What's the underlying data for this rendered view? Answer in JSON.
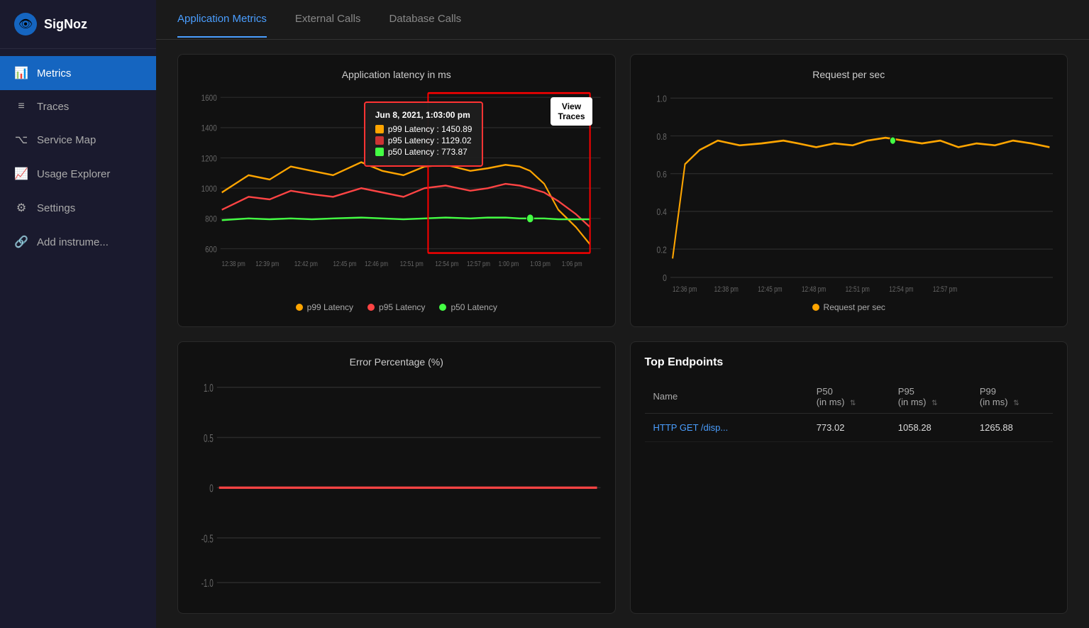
{
  "app": {
    "name": "SigNoz"
  },
  "sidebar": {
    "items": [
      {
        "id": "metrics",
        "label": "Metrics",
        "icon": "📊",
        "active": true
      },
      {
        "id": "traces",
        "label": "Traces",
        "icon": "≡"
      },
      {
        "id": "service-map",
        "label": "Service Map",
        "icon": "⌥"
      },
      {
        "id": "usage-explorer",
        "label": "Usage Explorer",
        "icon": "📈"
      },
      {
        "id": "settings",
        "label": "Settings",
        "icon": "⚙"
      },
      {
        "id": "add-instrument",
        "label": "Add instrume...",
        "icon": "🔗"
      }
    ]
  },
  "tabs": [
    {
      "id": "application-metrics",
      "label": "Application Metrics",
      "active": true
    },
    {
      "id": "external-calls",
      "label": "External Calls",
      "active": false
    },
    {
      "id": "database-calls",
      "label": "Database Calls",
      "active": false
    }
  ],
  "latency_chart": {
    "title": "Application latency in ms",
    "y_axis": [
      "1600",
      "1400",
      "1200",
      "1000",
      "800",
      "600"
    ],
    "x_axis": [
      "12:38 pm",
      "12:39 pm",
      "12:42 pm",
      "12:45 pm",
      "12:46 pm",
      "12:51 pm",
      "12:54 pm",
      "12:57 pm",
      "1:00 pm",
      "1:03 pm",
      "1:06 pm"
    ],
    "tooltip": {
      "date": "Jun 8, 2021, 1:03:00 pm",
      "p99_label": "p99 Latency : 1450.89",
      "p95_label": "p95 Latency : 1129.02",
      "p50_label": "p50 Latency : 773.87"
    },
    "view_traces_btn": "View\nTraces",
    "legend": [
      {
        "label": "p99 Latency",
        "color": "#ffa500"
      },
      {
        "label": "p95 Latency",
        "color": "#ff4444"
      },
      {
        "label": "p50 Latency",
        "color": "#44ff44"
      }
    ]
  },
  "request_chart": {
    "title": "Request per sec",
    "y_axis": [
      "1.0",
      "0.8",
      "0.6",
      "0.4",
      "0.2",
      "0"
    ],
    "legend": [
      {
        "label": "Request per sec",
        "color": "#ffa500"
      }
    ]
  },
  "error_chart": {
    "title": "Error Percentage (%)",
    "y_axis": [
      "1.0",
      "0.5",
      "0",
      "-0.5",
      "-1.0"
    ]
  },
  "top_endpoints": {
    "title": "Top Endpoints",
    "columns": [
      {
        "label": "Name",
        "sortable": false
      },
      {
        "label": "P50\n(in ms)",
        "sortable": true
      },
      {
        "label": "P95\n(in ms)",
        "sortable": true
      },
      {
        "label": "P99\n(in ms)",
        "sortable": true
      }
    ],
    "rows": [
      {
        "name": "HTTP GET /disp...",
        "p50": "773.02",
        "p95": "1058.28",
        "p99": "1265.88"
      }
    ]
  }
}
